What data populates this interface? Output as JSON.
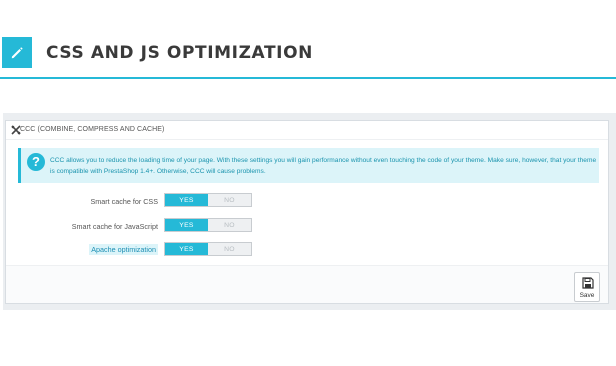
{
  "header": {
    "title": "CSS AND JS OPTIMIZATION",
    "icon": "pencil-icon",
    "accent": "#25b9d7"
  },
  "panel": {
    "heading_icon": "tools-icon",
    "heading": "CCC (COMBINE, COMPRESS AND CACHE)",
    "alert": {
      "icon": "question-icon",
      "text": "CCC allows you to reduce the loading time of your page. With these settings you will gain performance without even touching the code of your theme. Make sure, however, that your theme is compatible with PrestaShop 1.4+. Otherwise, CCC will cause problems."
    },
    "rows": [
      {
        "label": "Smart cache for CSS",
        "yes": "YES",
        "no": "NO",
        "value": "YES"
      },
      {
        "label": "Smart cache for JavaScript",
        "yes": "YES",
        "no": "NO",
        "value": "YES"
      },
      {
        "label": "Apache optimization",
        "yes": "YES",
        "no": "NO",
        "value": "YES"
      }
    ],
    "footer": {
      "save_icon": "floppy-disk-icon",
      "save_label": "Save"
    }
  }
}
